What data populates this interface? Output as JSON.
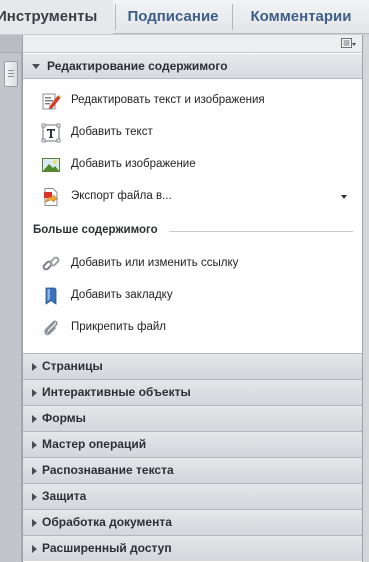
{
  "tabs": [
    {
      "label": "Инструменты"
    },
    {
      "label": "Подписание"
    },
    {
      "label": "Комментарии"
    }
  ],
  "expanded_section": {
    "title": "Редактирование содержимого",
    "items": [
      {
        "label": "Редактировать текст и изображения",
        "icon": "edit-text-images-icon"
      },
      {
        "label": "Добавить текст",
        "icon": "add-text-icon"
      },
      {
        "label": "Добавить изображение",
        "icon": "add-image-icon"
      },
      {
        "label": "Экспорт файла в...",
        "icon": "export-file-icon"
      }
    ],
    "more_title": "Больше содержимого",
    "more_items": [
      {
        "label": "Добавить или изменить ссылку",
        "icon": "link-icon"
      },
      {
        "label": "Добавить закладку",
        "icon": "bookmark-icon"
      },
      {
        "label": "Прикрепить файл",
        "icon": "paperclip-icon"
      }
    ]
  },
  "collapsed_sections": [
    {
      "title": "Страницы"
    },
    {
      "title": "Интерактивные объекты"
    },
    {
      "title": "Формы"
    },
    {
      "title": "Мастер операций"
    },
    {
      "title": "Распознавание текста"
    },
    {
      "title": "Защита"
    },
    {
      "title": "Обработка документа"
    },
    {
      "title": "Расширенный доступ"
    }
  ],
  "colors": {
    "active_tab_text": "#3b3e42",
    "inactive_tab_text": "#3f5f87",
    "panel_bg": "#ffffff",
    "section_header_bg": "#d6d9dd"
  }
}
